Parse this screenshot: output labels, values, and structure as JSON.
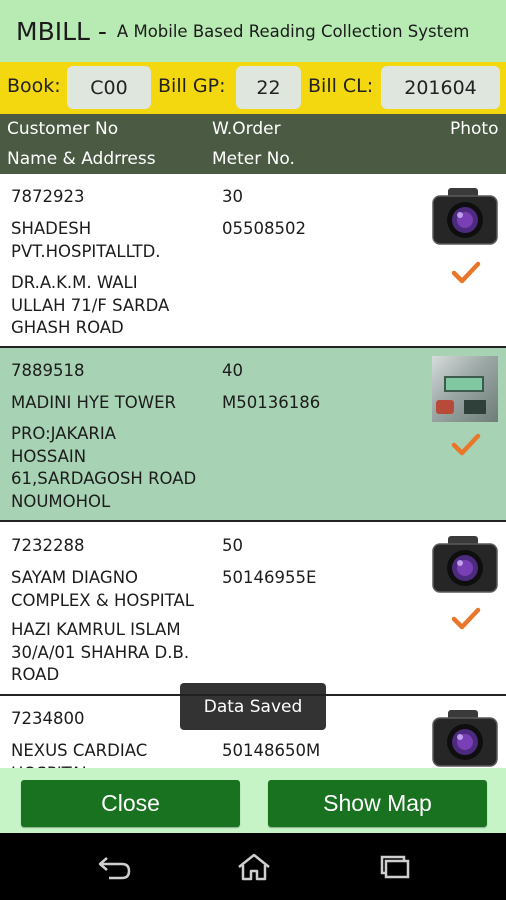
{
  "header": {
    "app_name": "MBILL -",
    "subtitle": "A Mobile Based Reading Collection System"
  },
  "info": {
    "book_label": "Book:",
    "book_value": "C00",
    "bill_gp_label": "Bill GP:",
    "bill_gp_value": "22",
    "bill_cl_label": "Bill CL:",
    "bill_cl_value": "201604"
  },
  "columns": {
    "customer_no": "Customer No",
    "name_address": "Name & Addrress",
    "work_order": "W.Order",
    "meter_no": "Meter No.",
    "photo": "Photo"
  },
  "rows": [
    {
      "customer_no": "7872923",
      "name": "SHADESH\nPVT.HOSPITALLTD.",
      "address": "DR.A.K.M. WALI\nULLAH 71/F SARDA\nGHASH ROAD",
      "w_order": "30",
      "meter_no": "05508502",
      "photo": "camera-icon",
      "checked": true
    },
    {
      "customer_no": "7889518",
      "name": "MADINI HYE TOWER",
      "address": "PRO:JAKARIA\nHOSSAIN\n61,SARDAGOSH ROAD\nNOUMOHOL",
      "w_order": "40",
      "meter_no": "M50136186",
      "photo": "meter-photo",
      "checked": true
    },
    {
      "customer_no": "7232288",
      "name": "SAYAM DIAGNO\nCOMPLEX & HOSPITAL",
      "address": "HAZI KAMRUL ISLAM\n30/A/01 SHAHRA D.B.\nROAD",
      "w_order": "50",
      "meter_no": "50146955E",
      "photo": "camera-icon",
      "checked": true
    },
    {
      "customer_no": "7234800",
      "name": "NEXUS CARDIAC\nHOSPITAL",
      "address": "",
      "w_order": "",
      "meter_no": "50148650M",
      "photo": "camera-icon",
      "checked": false
    }
  ],
  "toast": "Data Saved",
  "buttons": {
    "close": "Close",
    "show_map": "Show Map"
  },
  "nav": [
    "back-icon",
    "home-icon",
    "recents-icon"
  ],
  "colors": {
    "title_bg": "#b8ebb4",
    "info_bg": "#f3d70f",
    "header_bg": "#4b5a43",
    "selected_row": "#a7d2b4",
    "button": "#197220",
    "button_bar": "#c6f4c7",
    "check": "#e8772a"
  }
}
